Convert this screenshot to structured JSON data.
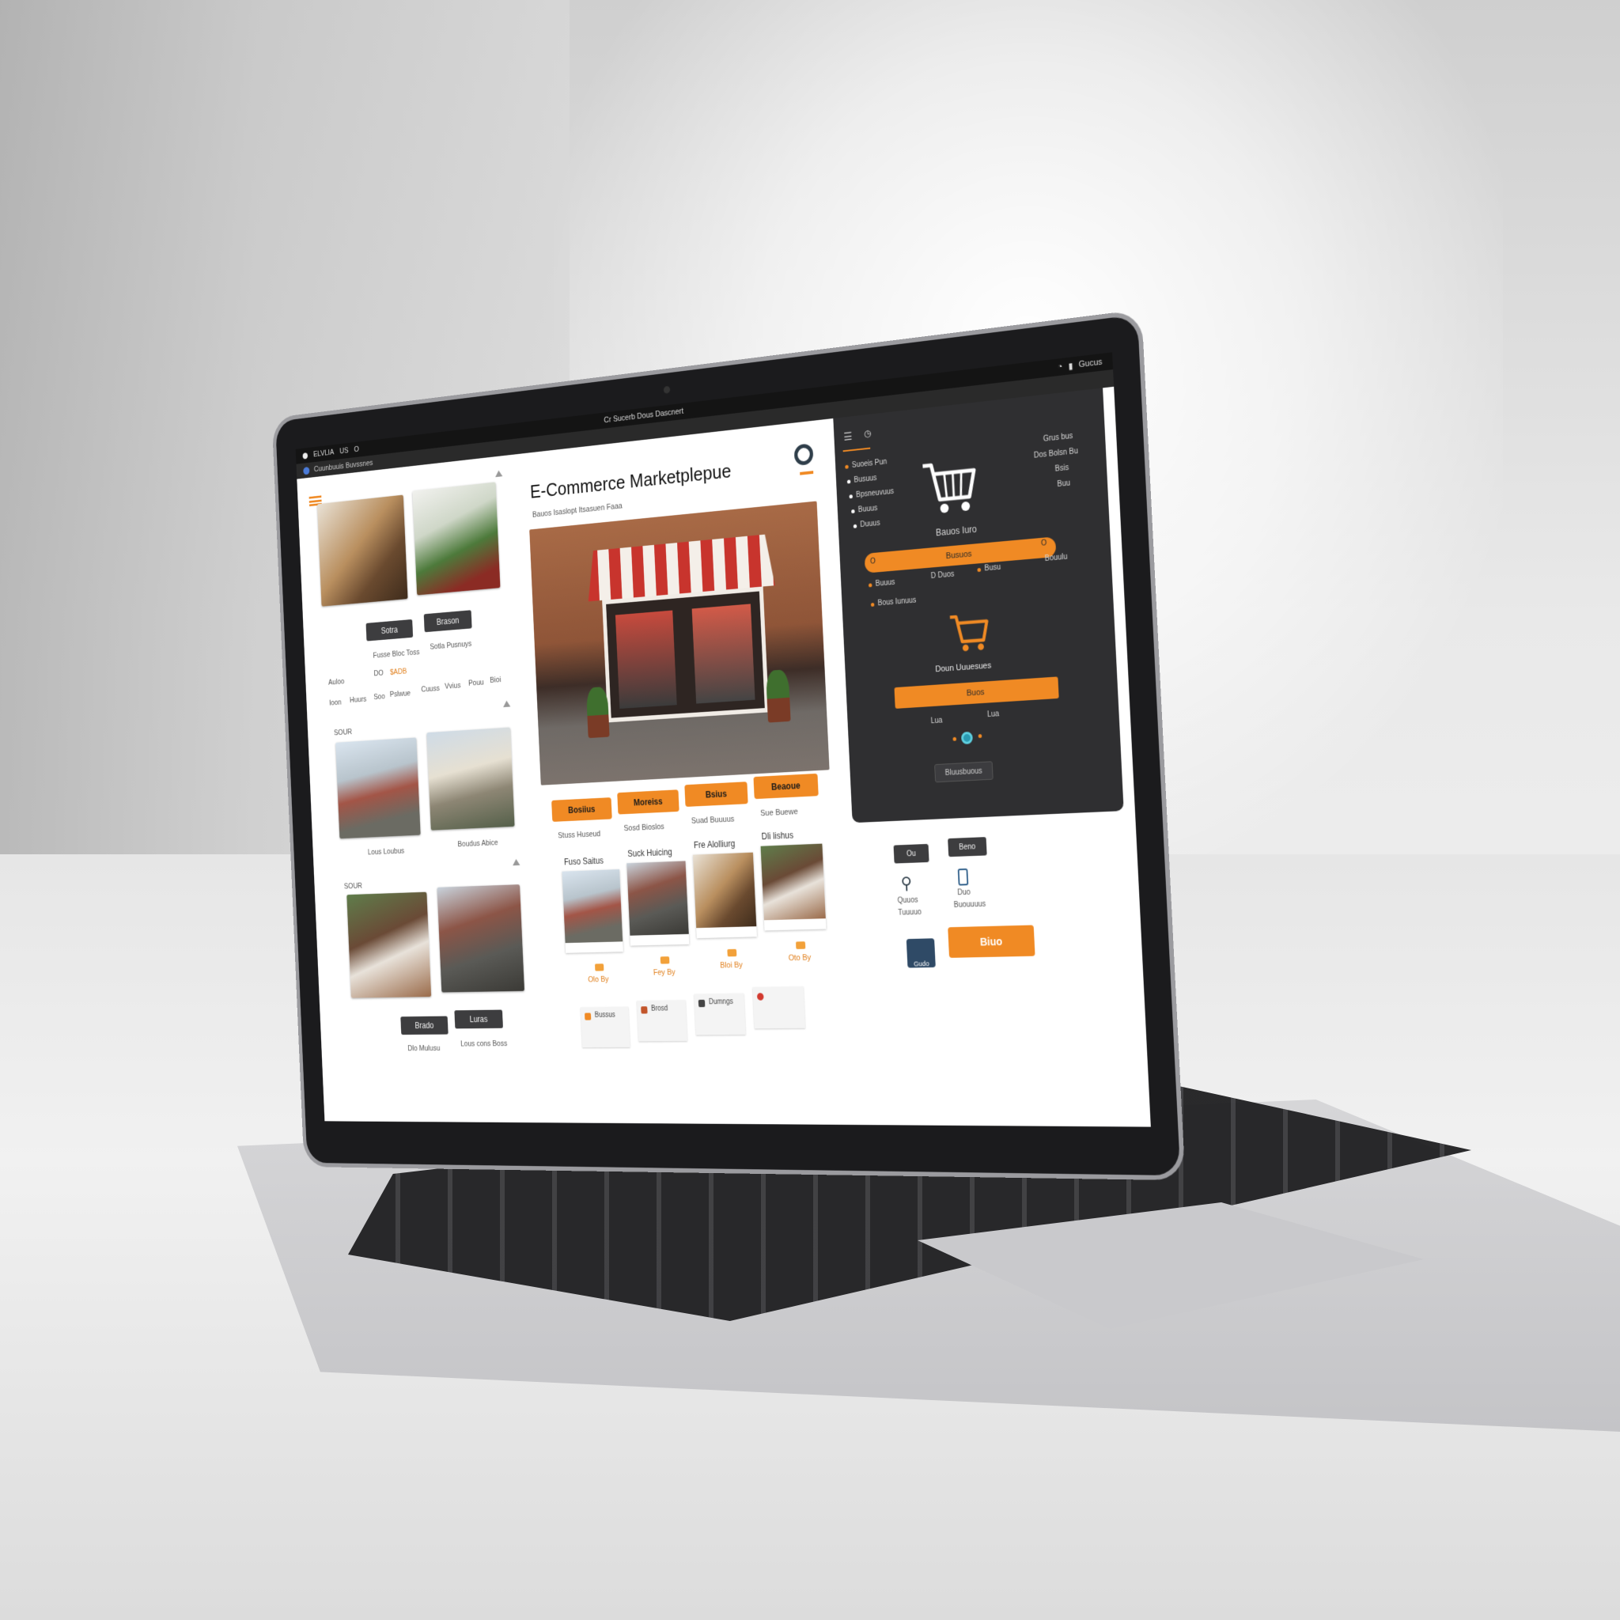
{
  "menubar": {
    "app": "ELVLIA",
    "menu_a": "US",
    "menu_b": "O",
    "window_title": "Cr Sucerb Dous Dascnert",
    "status_right": "Gucus"
  },
  "tabbar": {
    "tab_label": "Cuunbuuis Buvssnes"
  },
  "left": {
    "gallery_buttons": [
      "Sotra",
      "Brason"
    ],
    "gallery_captions": [
      "Fusse Bloc Toss",
      "Sotla Pusnuys"
    ],
    "price_label": "Auloo",
    "price_a": "DO",
    "price_b": "$ADB",
    "filters": [
      "Ioon",
      "Huurs",
      "Soo",
      "Pslwue",
      "Cuuss",
      "Vvius",
      "Pouu",
      "Bioi"
    ],
    "section1_label": "SOUR",
    "section1_captions": [
      "Lous Loubus",
      "Boudus Abice"
    ],
    "section2_label": "SOUR",
    "section2_buttons": [
      "Brado",
      "Luras"
    ],
    "section2_captions": [
      "Dlo Mulusu",
      "Lous cons Boss"
    ]
  },
  "main": {
    "title": "E-Commerce Marketplepue",
    "subtitle": "Bauos Isaslopt Itsasuen Faaa",
    "category_buttons": [
      "Bosiius",
      "Moreiss",
      "Bsius",
      "Beaoue"
    ],
    "category_captions": [
      "Stuss Huseud",
      "Sosd Bioslos",
      "Suad Buuuus",
      "Sue Buewe"
    ],
    "products": [
      {
        "title": "Fuso Saitus",
        "buy": "Olo By"
      },
      {
        "title": "Suck Huicing",
        "buy": "Fey By"
      },
      {
        "title": "Fre Alolliurg",
        "buy": "Bloi By"
      },
      {
        "title": "Dli lishus",
        "buy": "Oto By"
      }
    ],
    "minis": [
      "Bussus",
      "Brosd",
      "Dumngs",
      ""
    ]
  },
  "panel": {
    "menu_items": [
      "Suoeis Pun",
      "Busuus",
      "Bpsneuvuus",
      "Buuus",
      "Duuus"
    ],
    "right_items": [
      "Grus bus",
      "Dos Bolsn Bu",
      "Bsis",
      "Buu"
    ],
    "cart_label": "Bauos Iuro",
    "progress_label": "Busuos",
    "progress_left": "O",
    "progress_right": "O",
    "stats": [
      "Buuus",
      "D Duos",
      "Busu",
      "Bouulu"
    ],
    "stat_note": "Bous Iunuus",
    "cart2_label": "Doun Uuuesues",
    "checkout": "Buos",
    "foot_a": "Lua",
    "foot_b": "Lua",
    "account_button": "Bluusbuous",
    "accent": "#f08a24",
    "bg": "#2f2f31"
  },
  "lower_right": {
    "buttons": [
      "Ou",
      "Beno"
    ],
    "search_label": "Quuos",
    "search_sub": "Tuuuuo",
    "user_label": "Duo",
    "user_sub": "Buouuuus",
    "avatar_label": "Gudo",
    "cta": "Biuo"
  }
}
